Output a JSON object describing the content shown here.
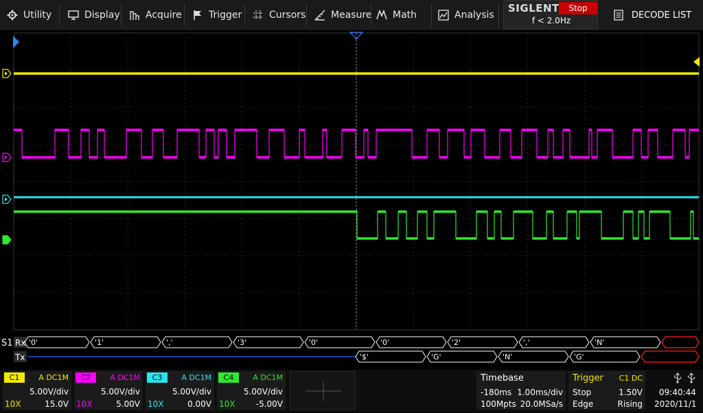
{
  "menu": {
    "utility": "Utility",
    "display": "Display",
    "acquire": "Acquire",
    "trigger": "Trigger",
    "cursors": "Cursors",
    "measure": "Measure",
    "math": "Math",
    "analysis": "Analysis",
    "decode_list": "DECODE LIST"
  },
  "brand": {
    "name": "SIGLENT",
    "run_state": "Stop",
    "trigger_freq": "f < 2.0Hz"
  },
  "decode": {
    "bus_label": "S1",
    "rx_label": "Rx",
    "tx_label": "Tx",
    "rx_frames": [
      "'0'",
      "'1'",
      "','",
      "'3'",
      "'0'",
      "'0'",
      "'2'",
      "','",
      "'N'"
    ],
    "tx_frames": [
      "'$'",
      "'G'",
      "'N'",
      "'G'"
    ]
  },
  "channels": [
    {
      "tag": "C1",
      "coupling": "A DC1M",
      "scale": "5.00V/div",
      "probe": "10X",
      "offset": "15.0V",
      "color": "#f2ea00"
    },
    {
      "tag": "C2",
      "coupling": "A DC1M",
      "scale": "5.00V/div",
      "probe": "10X",
      "offset": "5.00V",
      "color": "#ff00ff"
    },
    {
      "tag": "C3",
      "coupling": "A DC1M",
      "scale": "5.00V/div",
      "probe": "10X",
      "offset": "0.00V",
      "color": "#29e4f0"
    },
    {
      "tag": "C4",
      "coupling": "A DC1M",
      "scale": "5.00V/div",
      "probe": "10X",
      "offset": "-5.00V",
      "color": "#30e830"
    }
  ],
  "timebase": {
    "title": "Timebase",
    "delay": "-180ms",
    "scale": "1.00ms/div",
    "memory": "100Mpts",
    "sample_rate": "20.0MSa/s"
  },
  "trigger_info": {
    "title": "Trigger",
    "source": "C1 DC",
    "mode": "Stop",
    "level": "1.50V",
    "type": "Edge",
    "slope": "Rising"
  },
  "clock": {
    "time": "09:40:44",
    "date": "2020/11/1"
  },
  "icons": [
    "gear-icon",
    "monitor-icon",
    "acquire-icon",
    "flag-icon",
    "cursor-icon",
    "measure-icon",
    "math-icon",
    "analysis-icon",
    "list-icon",
    "usb-icon",
    "crosshair-icon"
  ]
}
